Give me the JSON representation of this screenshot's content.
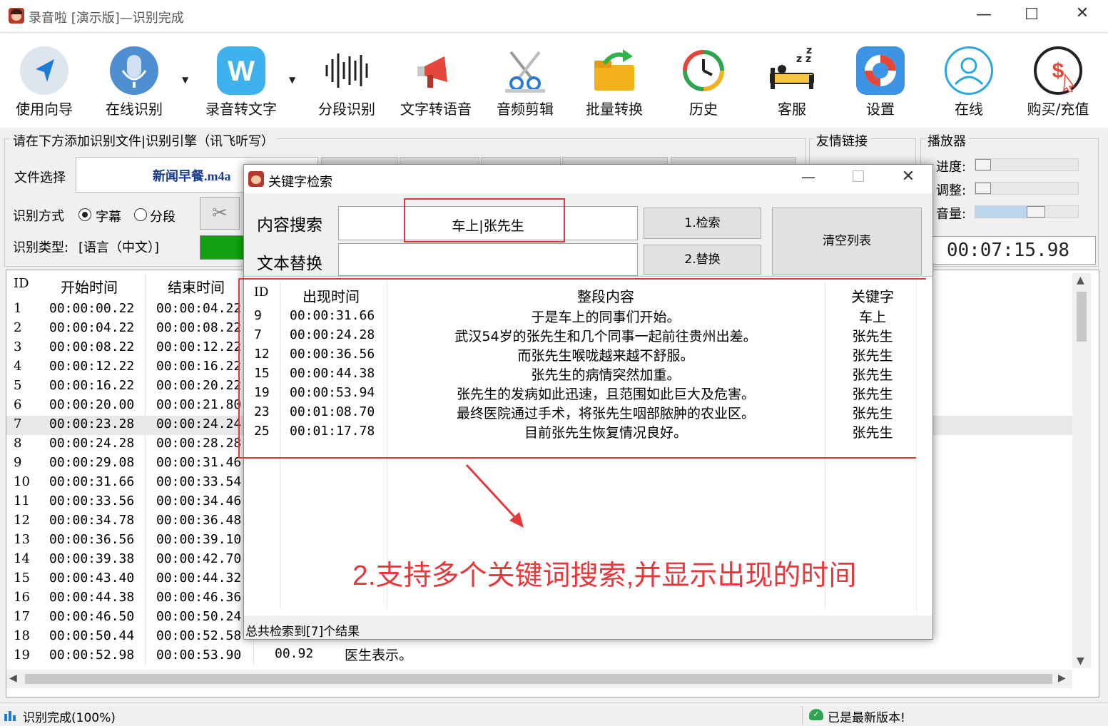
{
  "app": {
    "title": "录音啦 [演示版]—识别完成"
  },
  "toolbar": {
    "items": [
      {
        "label": "使用向导",
        "icon": "guide-arrow-icon"
      },
      {
        "label": "在线识别",
        "icon": "microphone-icon"
      },
      {
        "label": "录音转文字",
        "icon": "w-logo-icon"
      },
      {
        "label": "分段识别",
        "icon": "waveform-icon"
      },
      {
        "label": "文字转语音",
        "icon": "megaphone-icon"
      },
      {
        "label": "音频剪辑",
        "icon": "scissors-icon"
      },
      {
        "label": "批量转换",
        "icon": "folder-arrow-icon"
      },
      {
        "label": "历史",
        "icon": "history-clock-icon"
      },
      {
        "label": "客服",
        "icon": "sleeping-bed-icon"
      },
      {
        "label": "设置",
        "icon": "lifebuoy-icon"
      },
      {
        "label": "在线",
        "icon": "user-outline-icon"
      },
      {
        "label": "购买/充值",
        "icon": "dollar-coin-icon"
      }
    ]
  },
  "panel": {
    "group_title": "请在下方添加识别文件|识别引擎（讯飞听写）",
    "file_label": "文件选择",
    "file_value": "新闻早餐.m4a",
    "mode_label": "识别方式",
    "mode_options": [
      "字幕",
      "分段"
    ],
    "type_label": "识别类型:",
    "type_value": "[语言（中文）]"
  },
  "links": {
    "title": "友情链接"
  },
  "player": {
    "title": "播放器",
    "progress_label": "进度:",
    "adjust_label": "调整:",
    "volume_label": "音量:",
    "time": "00:07:15.98"
  },
  "grid": {
    "headers": [
      "ID",
      "开始时间",
      "结束时间"
    ],
    "rows": [
      {
        "id": "1",
        "start": "00:00:00.22",
        "end": "00:00:04.22"
      },
      {
        "id": "2",
        "start": "00:00:04.22",
        "end": "00:00:08.22"
      },
      {
        "id": "3",
        "start": "00:00:08.22",
        "end": "00:00:12.22"
      },
      {
        "id": "4",
        "start": "00:00:12.22",
        "end": "00:00:16.22"
      },
      {
        "id": "5",
        "start": "00:00:16.22",
        "end": "00:00:20.22"
      },
      {
        "id": "6",
        "start": "00:00:20.00",
        "end": "00:00:21.80"
      },
      {
        "id": "7",
        "start": "00:00:23.28",
        "end": "00:00:24.24"
      },
      {
        "id": "8",
        "start": "00:00:24.28",
        "end": "00:00:28.28"
      },
      {
        "id": "9",
        "start": "00:00:29.08",
        "end": "00:00:31.46"
      },
      {
        "id": "10",
        "start": "00:00:31.66",
        "end": "00:00:33.54"
      },
      {
        "id": "11",
        "start": "00:00:33.56",
        "end": "00:00:34.46"
      },
      {
        "id": "12",
        "start": "00:00:34.78",
        "end": "00:00:36.48"
      },
      {
        "id": "13",
        "start": "00:00:36.56",
        "end": "00:00:39.10"
      },
      {
        "id": "14",
        "start": "00:00:39.38",
        "end": "00:00:42.70"
      },
      {
        "id": "15",
        "start": "00:00:43.40",
        "end": "00:00:44.32"
      },
      {
        "id": "16",
        "start": "00:00:44.38",
        "end": "00:00:46.36"
      },
      {
        "id": "17",
        "start": "00:00:46.50",
        "end": "00:00:50.24"
      },
      {
        "id": "18",
        "start": "00:00:50.44",
        "end": "00:00:52.58"
      },
      {
        "id": "19",
        "start": "00:00:52.98",
        "end": "00:00:53.90",
        "dur": "00.92",
        "text": "医生表示。"
      }
    ]
  },
  "dialog": {
    "title": "关键字检索",
    "search_label": "内容搜索",
    "search_value": "车上|张先生",
    "replace_label": "文本替换",
    "replace_value": "",
    "search_button": "1.检索",
    "replace_button": "2.替换",
    "clear_button": "清空列表",
    "headers": [
      "ID",
      "出现时间",
      "整段内容",
      "关键字"
    ],
    "results": [
      {
        "id": "9",
        "time": "00:00:31.66",
        "content": "于是车上的同事们开始。",
        "keyword": "车上"
      },
      {
        "id": "7",
        "time": "00:00:24.28",
        "content": "武汉54岁的张先生和几个同事一起前往贵州出差。",
        "keyword": "张先生"
      },
      {
        "id": "12",
        "time": "00:00:36.56",
        "content": "而张先生喉咙越来越不舒服。",
        "keyword": "张先生"
      },
      {
        "id": "15",
        "time": "00:00:44.38",
        "content": "张先生的病情突然加重。",
        "keyword": "张先生"
      },
      {
        "id": "19",
        "time": "00:00:53.94",
        "content": "张先生的发病如此迅速，且范围如此巨大及危害。",
        "keyword": "张先生"
      },
      {
        "id": "23",
        "time": "00:01:08.70",
        "content": "最终医院通过手术，将张先生咽部脓肿的农业区。",
        "keyword": "张先生"
      },
      {
        "id": "25",
        "time": "00:01:17.78",
        "content": "目前张先生恢复情况良好。",
        "keyword": "张先生"
      }
    ],
    "annotation": "2.支持多个关键词搜索,并显示出现的时间",
    "status": "总共检索到[7]个结果"
  },
  "statusbar": {
    "left": "识别完成(100%)",
    "right": "已是最新版本!"
  },
  "colors": {
    "accent_red": "#e5383b",
    "progress_green": "#0fa10f"
  }
}
